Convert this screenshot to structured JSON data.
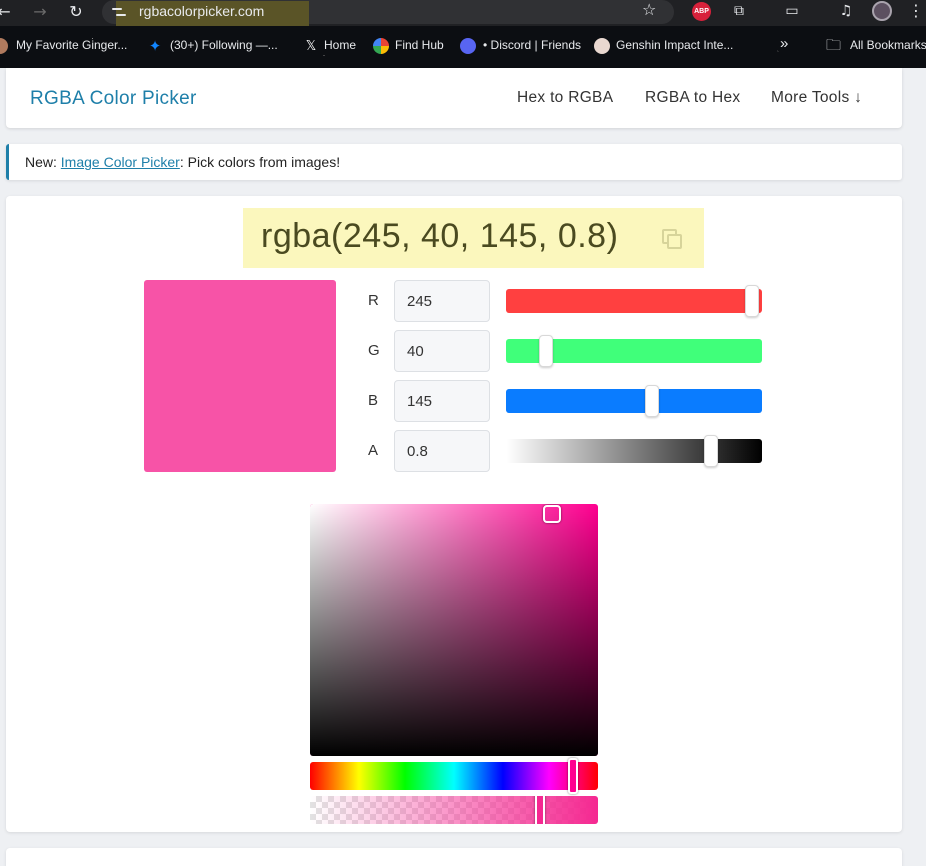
{
  "browser": {
    "url": "rgbacolorpicker.com",
    "bookmarks": [
      {
        "label": "My Favorite Ginger...",
        "icon": "avatar-icon"
      },
      {
        "label": "(30+) Following —...",
        "icon": "bluesky-icon"
      },
      {
        "label": "Home",
        "icon": "x-icon"
      },
      {
        "label": "Find Hub",
        "icon": "google-icon"
      },
      {
        "label": "• Discord | Friends",
        "icon": "discord-icon"
      },
      {
        "label": "Genshin Impact Inte...",
        "icon": "genshin-icon"
      }
    ],
    "overflow": "»",
    "all_bookmarks": "All Bookmarks",
    "extension_badge": "ABP"
  },
  "header": {
    "brand": "RGBA Color Picker",
    "nav": [
      "Hex to RGBA",
      "RGBA to Hex",
      "More Tools ↓"
    ]
  },
  "notice": {
    "prefix": "New: ",
    "link": "Image Color Picker",
    "suffix": ": Pick colors from images!"
  },
  "picker": {
    "color_string": "rgba(245, 40, 145, 0.8)",
    "channels": [
      {
        "label": "R",
        "value": "245",
        "fraction": 0.961,
        "color": "#ff4040"
      },
      {
        "label": "G",
        "value": "40",
        "fraction": 0.157,
        "color": "#40ff7a"
      },
      {
        "label": "B",
        "value": "145",
        "fraction": 0.569,
        "color": "#0a7cff"
      },
      {
        "label": "A",
        "value": "0.8",
        "fraction": 0.8,
        "color": "#000000"
      }
    ],
    "hue_fraction": 0.914,
    "saturation": 0.84,
    "value": 0.96,
    "hue_color": "#ff0090",
    "alpha_fraction": 0.8,
    "alpha_color": "#f52891"
  }
}
